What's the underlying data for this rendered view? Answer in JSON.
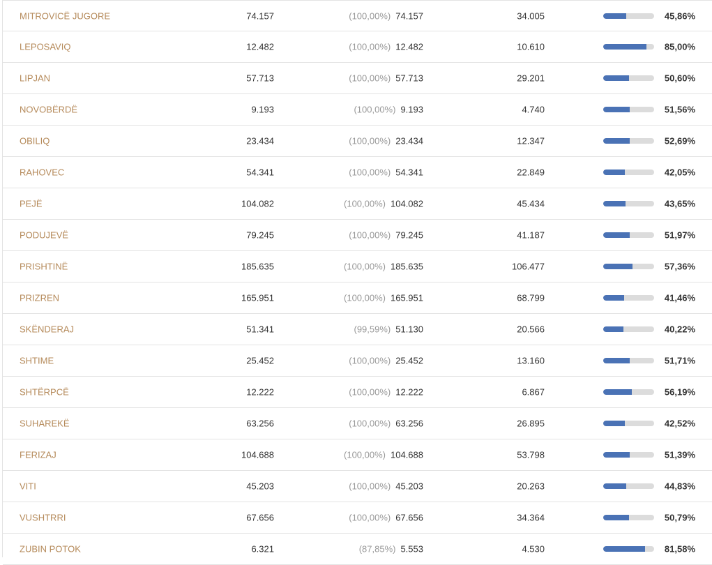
{
  "table": {
    "rows": [
      {
        "municipality": "MITROVICË JUGORE",
        "voters": "74.157",
        "counted_pct": "(100,00%)",
        "counted": "74.157",
        "voted": "34.005",
        "turnout": "45,86%",
        "turnout_fraction": 0.4586
      },
      {
        "municipality": "LEPOSAVIQ",
        "voters": "12.482",
        "counted_pct": "(100,00%)",
        "counted": "12.482",
        "voted": "10.610",
        "turnout": "85,00%",
        "turnout_fraction": 0.85
      },
      {
        "municipality": "LIPJAN",
        "voters": "57.713",
        "counted_pct": "(100,00%)",
        "counted": "57.713",
        "voted": "29.201",
        "turnout": "50,60%",
        "turnout_fraction": 0.506
      },
      {
        "municipality": "NOVOBËRDË",
        "voters": "9.193",
        "counted_pct": "(100,00%)",
        "counted": "9.193",
        "voted": "4.740",
        "turnout": "51,56%",
        "turnout_fraction": 0.5156
      },
      {
        "municipality": "OBILIQ",
        "voters": "23.434",
        "counted_pct": "(100,00%)",
        "counted": "23.434",
        "voted": "12.347",
        "turnout": "52,69%",
        "turnout_fraction": 0.5269
      },
      {
        "municipality": "RAHOVEC",
        "voters": "54.341",
        "counted_pct": "(100,00%)",
        "counted": "54.341",
        "voted": "22.849",
        "turnout": "42,05%",
        "turnout_fraction": 0.4205
      },
      {
        "municipality": "PEJË",
        "voters": "104.082",
        "counted_pct": "(100,00%)",
        "counted": "104.082",
        "voted": "45.434",
        "turnout": "43,65%",
        "turnout_fraction": 0.4365
      },
      {
        "municipality": "PODUJEVË",
        "voters": "79.245",
        "counted_pct": "(100,00%)",
        "counted": "79.245",
        "voted": "41.187",
        "turnout": "51,97%",
        "turnout_fraction": 0.5197
      },
      {
        "municipality": "PRISHTINË",
        "voters": "185.635",
        "counted_pct": "(100,00%)",
        "counted": "185.635",
        "voted": "106.477",
        "turnout": "57,36%",
        "turnout_fraction": 0.5736
      },
      {
        "municipality": "PRIZREN",
        "voters": "165.951",
        "counted_pct": "(100,00%)",
        "counted": "165.951",
        "voted": "68.799",
        "turnout": "41,46%",
        "turnout_fraction": 0.4146
      },
      {
        "municipality": "SKËNDERAJ",
        "voters": "51.341",
        "counted_pct": "(99,59%)",
        "counted": "51.130",
        "voted": "20.566",
        "turnout": "40,22%",
        "turnout_fraction": 0.4022
      },
      {
        "municipality": "SHTIME",
        "voters": "25.452",
        "counted_pct": "(100,00%)",
        "counted": "25.452",
        "voted": "13.160",
        "turnout": "51,71%",
        "turnout_fraction": 0.5171
      },
      {
        "municipality": "SHTËRPCË",
        "voters": "12.222",
        "counted_pct": "(100,00%)",
        "counted": "12.222",
        "voted": "6.867",
        "turnout": "56,19%",
        "turnout_fraction": 0.5619
      },
      {
        "municipality": "SUHAREKË",
        "voters": "63.256",
        "counted_pct": "(100,00%)",
        "counted": "63.256",
        "voted": "26.895",
        "turnout": "42,52%",
        "turnout_fraction": 0.4252
      },
      {
        "municipality": "FERIZAJ",
        "voters": "104.688",
        "counted_pct": "(100,00%)",
        "counted": "104.688",
        "voted": "53.798",
        "turnout": "51,39%",
        "turnout_fraction": 0.5139
      },
      {
        "municipality": "VITI",
        "voters": "45.203",
        "counted_pct": "(100,00%)",
        "counted": "45.203",
        "voted": "20.263",
        "turnout": "44,83%",
        "turnout_fraction": 0.4483
      },
      {
        "municipality": "VUSHTRRI",
        "voters": "67.656",
        "counted_pct": "(100,00%)",
        "counted": "67.656",
        "voted": "34.364",
        "turnout": "50,79%",
        "turnout_fraction": 0.5079
      },
      {
        "municipality": "ZUBIN POTOK",
        "voters": "6.321",
        "counted_pct": "(87,85%)",
        "counted": "5.553",
        "voted": "4.530",
        "turnout": "81,58%",
        "turnout_fraction": 0.8158
      }
    ]
  },
  "colors": {
    "municipality_link": "#b58a5a",
    "bar_fill": "#4a72b5",
    "bar_track": "#dcdcdc",
    "row_border": "#e3e3e3"
  }
}
